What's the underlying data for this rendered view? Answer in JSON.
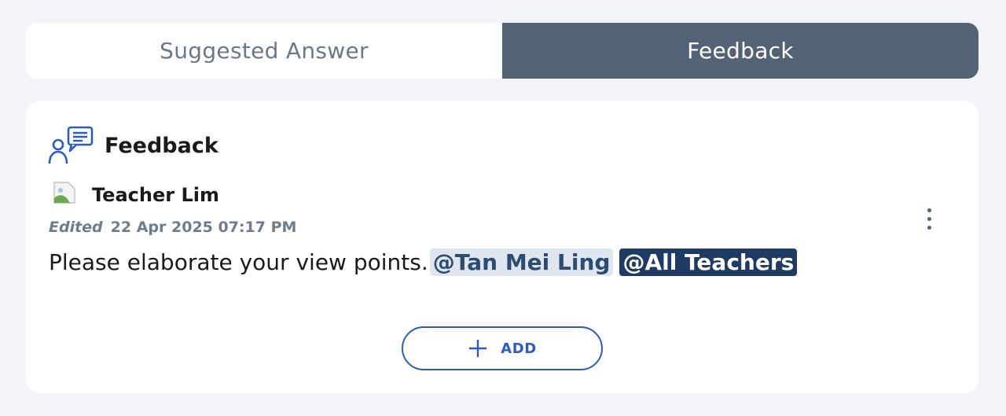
{
  "tabs": [
    {
      "label": "Suggested Answer",
      "active": false
    },
    {
      "label": "Feedback",
      "active": true
    }
  ],
  "card": {
    "title": "Feedback",
    "header_icon": "feedback-chat-icon",
    "author": {
      "name": "Teacher Lim",
      "avatar": "broken-image-icon"
    },
    "edited_label": "Edited",
    "timestamp": "22 Apr 2025 07:17 PM",
    "message": {
      "text": "Please elaborate your view points.",
      "mentions": [
        "@Tan Mei Ling",
        "@All Teachers"
      ]
    },
    "add_label": "ADD"
  },
  "colors": {
    "active_tab_bg": "#536375",
    "accent_blue": "#2c5cbf",
    "mention_dark_bg": "#1f3a63",
    "mention_light_bg": "#dfe6ef"
  }
}
